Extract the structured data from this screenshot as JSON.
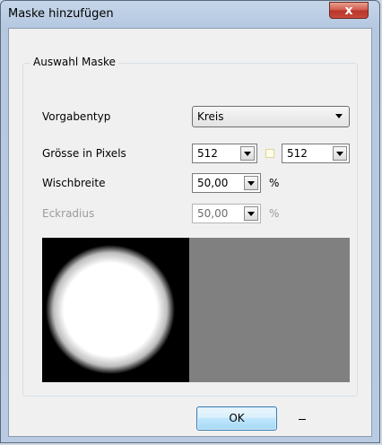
{
  "window": {
    "title": "Maske hinzufügen",
    "close_glyph": "x"
  },
  "group": {
    "title": "Auswahl Maske"
  },
  "fields": {
    "vorgabentyp": {
      "label": "Vorgabentyp",
      "value": "Kreis"
    },
    "groesse": {
      "label": "Grösse in Pixels",
      "width": "512",
      "height": "512",
      "linked": false
    },
    "wischbreite": {
      "label": "Wischbreite",
      "value": "50,00",
      "unit": "%"
    },
    "eckradius": {
      "label": "Eckradius",
      "value": "50,00",
      "unit": "%",
      "enabled": false
    }
  },
  "preview": {
    "mask_color": "#ffffff",
    "background_color": "#000000",
    "canvas_color": "#808080"
  },
  "buttons": {
    "ok": "OK"
  },
  "icons": {
    "close": "close-icon",
    "dropdown": "chevron-down-icon"
  }
}
